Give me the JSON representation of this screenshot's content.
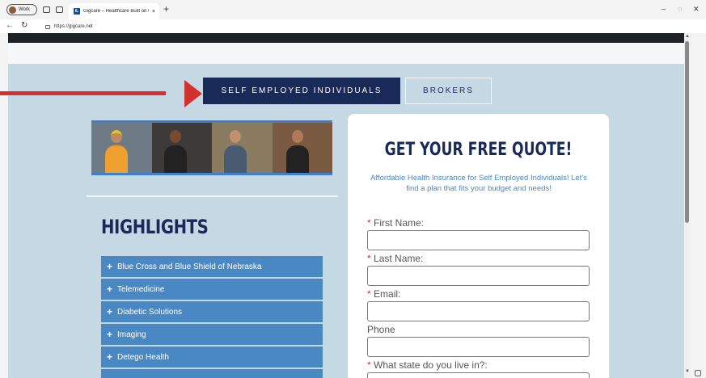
{
  "browser": {
    "profile_label": "Work",
    "tab_title": "Gigcare – Healthcare Built on Co",
    "tab_favicon": "iL",
    "url": "https://gigcare.net",
    "new_tab": "+",
    "tab_close": "×",
    "min": "–",
    "restore": "◌",
    "close": "✕"
  },
  "hero": {
    "primary_button": "SELF EMPLOYED INDIVIDUALS",
    "secondary_button": "BROKERS"
  },
  "highlights": {
    "title": "HIGHLIGHTS",
    "items": [
      "Blue Cross and Blue Shield of Nebraska",
      "Telemedicine",
      "Diabetic Solutions",
      "Imaging",
      "Detego Health"
    ]
  },
  "quote": {
    "title": "GET YOUR FREE QUOTE!",
    "subtitle": "Affordable Health Insurance for Self Employed Individuals! Let's find a plan that fits your budget and needs!",
    "fields": [
      {
        "label": "First Name:",
        "required": true
      },
      {
        "label": "Last Name:",
        "required": true
      },
      {
        "label": "Email:",
        "required": true
      },
      {
        "label": "Phone",
        "required": false
      },
      {
        "label": "What state do you live in?:",
        "required": true
      }
    ],
    "required_mark": "*"
  },
  "colors": {
    "navy": "#1a2a58",
    "accent_blue": "#4a88c4",
    "page_bg": "#c5d9e5",
    "annotation_red": "#d3302e"
  }
}
